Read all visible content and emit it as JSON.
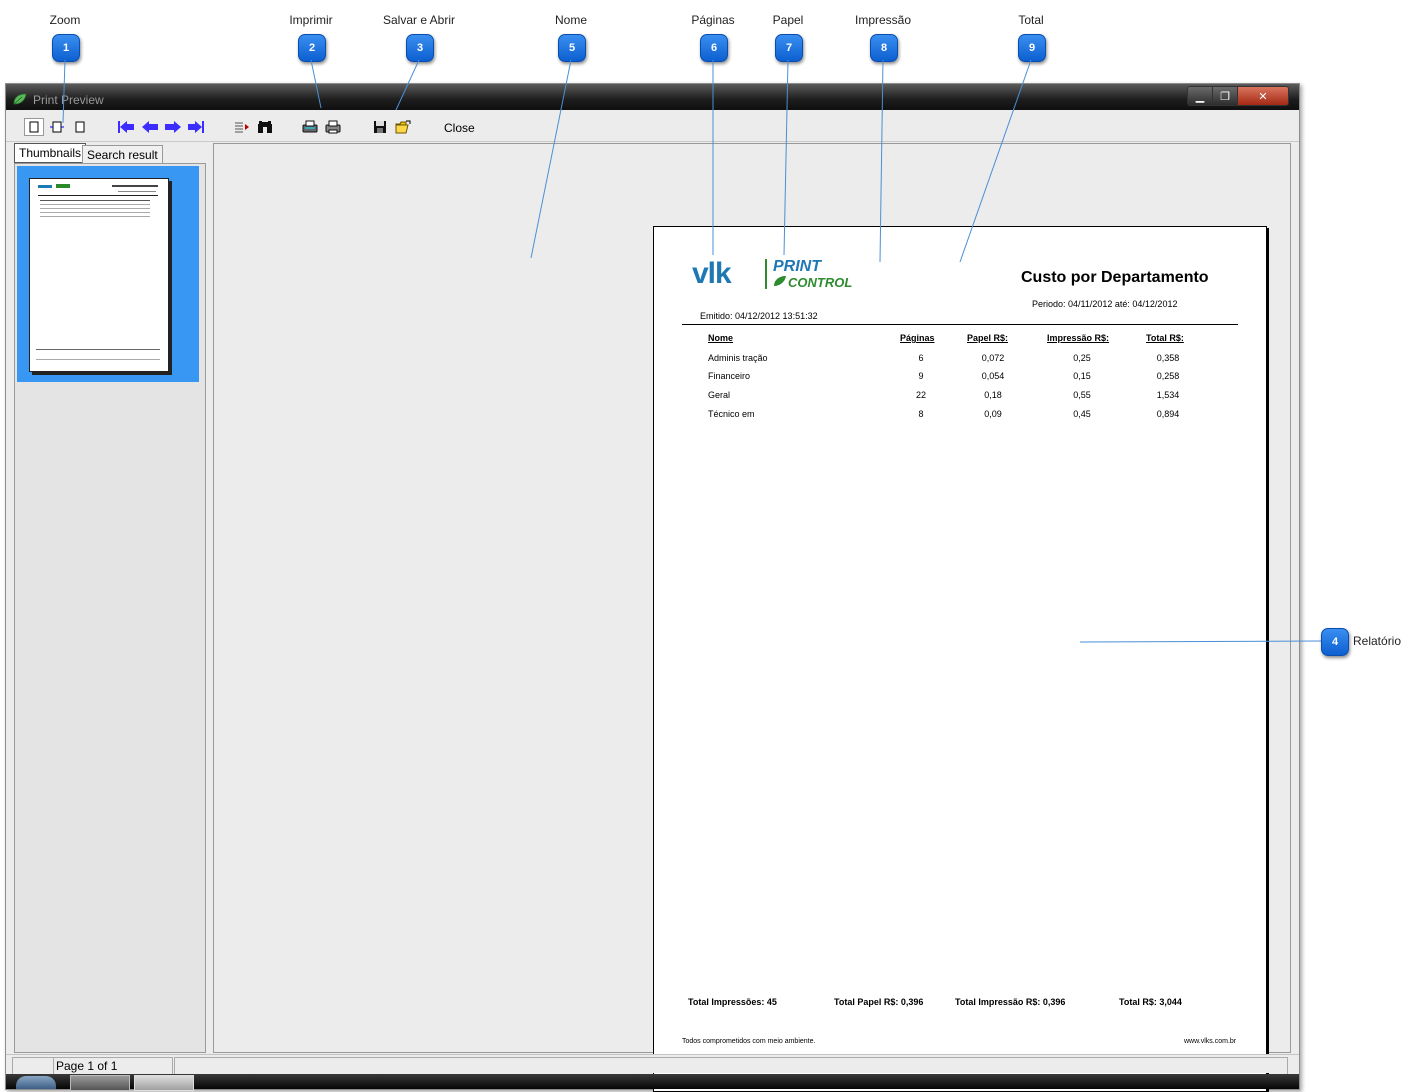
{
  "callouts": [
    {
      "num": "1",
      "label": "Zoom"
    },
    {
      "num": "2",
      "label": "Imprimir"
    },
    {
      "num": "3",
      "label": "Salvar e Abrir"
    },
    {
      "num": "5",
      "label": "Nome"
    },
    {
      "num": "6",
      "label": "Páginas"
    },
    {
      "num": "7",
      "label": "Papel"
    },
    {
      "num": "8",
      "label": "Impressão"
    },
    {
      "num": "9",
      "label": "Total"
    },
    {
      "num": "4",
      "label": "Relatório"
    }
  ],
  "window": {
    "title": "Print Preview",
    "close_label": "Close"
  },
  "tabs": {
    "thumbnails": "Thumbnails",
    "search_result": "Search result"
  },
  "status": {
    "page": "Page 1 of 1"
  },
  "report": {
    "logo_vlk": "vlk",
    "logo_print": "PRINT",
    "logo_control": "CONTROL",
    "title": "Custo por Departamento",
    "period": "Periodo:  04/11/2012  até:  04/12/2012",
    "emitted": "Emitido: 04/12/2012 13:51:32",
    "headers": {
      "nome": "Nome",
      "paginas": "Páginas",
      "papel": "Papel R$:",
      "impressao": "Impressão R$:",
      "total": "Total R$:"
    },
    "rows": [
      {
        "nome": "Adminis tração",
        "paginas": "6",
        "papel": "0,072",
        "impressao": "0,25",
        "total": "0,358"
      },
      {
        "nome": "Financeiro",
        "paginas": "9",
        "papel": "0,054",
        "impressao": "0,15",
        "total": "0,258"
      },
      {
        "nome": "Geral",
        "paginas": "22",
        "papel": "0,18",
        "impressao": "0,55",
        "total": "1,534"
      },
      {
        "nome": "Técnico em",
        "paginas": "8",
        "papel": "0,09",
        "impressao": "0,45",
        "total": "0,894"
      }
    ],
    "totals": {
      "impressoes": "Total Impressões: 45",
      "papel": "Total Papel R$: 0,396",
      "impressao": "Total Impressão R$: 0,396",
      "total": "Total R$: 3,044"
    },
    "footer_left": "Todos comprometidos com meio ambiente.",
    "footer_right": "www.vlks.com.br"
  }
}
